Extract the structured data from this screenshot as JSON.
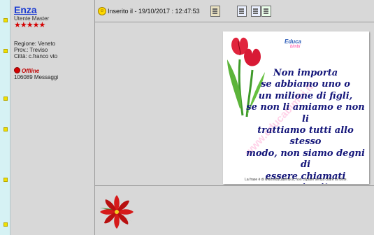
{
  "author": {
    "name": "Enza",
    "role": "Utente Master",
    "stars": "★★★★★",
    "region_label": "Regione: Veneto",
    "province_label": "Prov.: Treviso",
    "city_label": "Città: c.franco vto",
    "status": "Offline",
    "messages": "106089 Messaggi"
  },
  "post": {
    "posted_at": "Inserito il - 19/10/2017 : 12:47:53"
  },
  "image": {
    "logo_top": "Educa",
    "logo_bottom": "bimbi",
    "quote_lines": [
      "Non importa",
      "se abbiamo uno o",
      "un milione di figli,",
      "se non li amiamo e non li",
      "trattiamo tutti allo stesso",
      "modo, non siamo degni di",
      "essere chiamati genitori!"
    ],
    "watermark": "www.educabimbi.it",
    "footer": "La frase è di www.educabimbi.it, non copiare senza citare la fonte."
  },
  "colors": {
    "link_blue": "#1b3bd1",
    "star_red": "#d40000",
    "quote_blue": "#14167a"
  }
}
